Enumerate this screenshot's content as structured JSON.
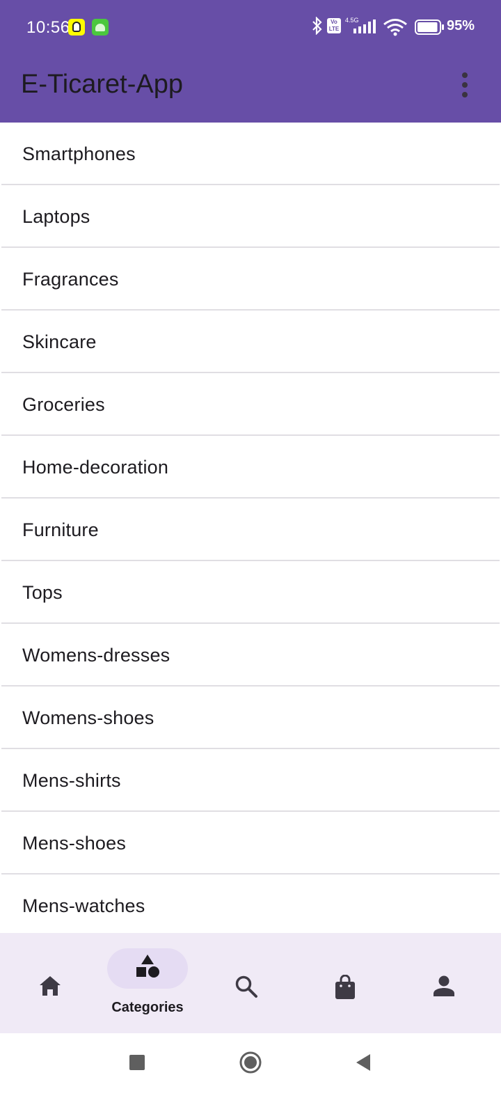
{
  "status_bar": {
    "time": "10:56",
    "icons": [
      "snapchat-icon",
      "android-app-icon",
      "bluetooth-icon",
      "volte-icon",
      "signal-icon",
      "wifi-icon",
      "battery-icon"
    ],
    "network_label": "4.5G",
    "volte_label": "Vo LTE",
    "battery_level": 95,
    "battery_text": "95%"
  },
  "app_bar": {
    "title": "E-Ticaret-App",
    "menu_icon": "more-vert-icon"
  },
  "colors": {
    "primary": "#674ea7",
    "nav_background": "#f0eaf6",
    "nav_indicator": "#e5dcf3",
    "text": "#1d1b20",
    "divider": "#e0dee3"
  },
  "categories": [
    {
      "label": "Smartphones"
    },
    {
      "label": "Laptops"
    },
    {
      "label": "Fragrances"
    },
    {
      "label": "Skincare"
    },
    {
      "label": "Groceries"
    },
    {
      "label": "Home-decoration"
    },
    {
      "label": "Furniture"
    },
    {
      "label": "Tops"
    },
    {
      "label": "Womens-dresses"
    },
    {
      "label": "Womens-shoes"
    },
    {
      "label": "Mens-shirts"
    },
    {
      "label": "Mens-shoes"
    },
    {
      "label": "Mens-watches"
    }
  ],
  "bottom_nav": {
    "items": [
      {
        "icon": "home-icon",
        "label": ""
      },
      {
        "icon": "categories-icon",
        "label": "Categories",
        "selected": true
      },
      {
        "icon": "search-icon",
        "label": ""
      },
      {
        "icon": "shopping-bag-icon",
        "label": ""
      },
      {
        "icon": "person-icon",
        "label": ""
      }
    ]
  },
  "system_nav": {
    "icons": [
      "recent-apps-icon",
      "home-circle-icon",
      "back-icon"
    ]
  }
}
